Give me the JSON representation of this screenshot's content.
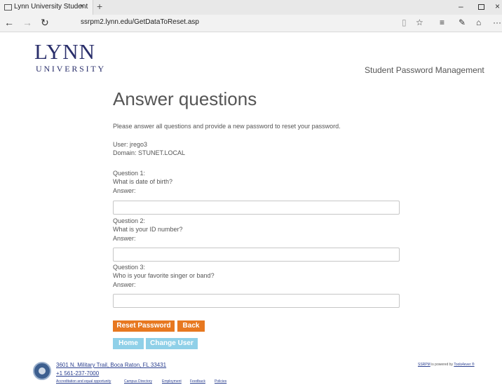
{
  "browser": {
    "tab_title": "Lynn University Student",
    "tab_close": "×",
    "new_tab": "+",
    "url": "ssrpm2.lynn.edu/GetDataToReset.asp",
    "window_min": "–",
    "window_close": "×",
    "more": "···"
  },
  "header": {
    "logo_main": "LYNN",
    "logo_sub": "UNIVERSITY",
    "app_title": "Student Password Management"
  },
  "main": {
    "heading": "Answer questions",
    "instructions": "Please answer all questions and provide a new password to reset your password.",
    "user_line": "User: jrego3",
    "domain_line": "Domain: STUNET.LOCAL",
    "answer_label": "Answer:",
    "questions": [
      {
        "number": "Question 1:",
        "text": "What is date of birth?",
        "value": ""
      },
      {
        "number": "Question 2:",
        "text": "What is your ID number?",
        "value": ""
      },
      {
        "number": "Question 3:",
        "text": "Who is your favorite singer or band?",
        "value": ""
      }
    ],
    "buttons": {
      "reset": "Reset Password",
      "back": "Back",
      "home": "Home",
      "change_user": "Change User"
    }
  },
  "footer": {
    "address": "3601 N. Military Trail, Boca Raton, FL 33431",
    "phone": "+1 561-237-7000",
    "links": [
      "Accreditation and equal opportunity",
      "Campus Directory",
      "Employment",
      "Feedback",
      "Policies"
    ],
    "powered_link": "SSRPM",
    "powered_text": " is powered by ",
    "vendor_link": "Tools4ever ®"
  },
  "colors": {
    "brand_navy": "#2a2f6b",
    "button_orange": "#e77820",
    "button_blue": "#8fd0e8"
  }
}
